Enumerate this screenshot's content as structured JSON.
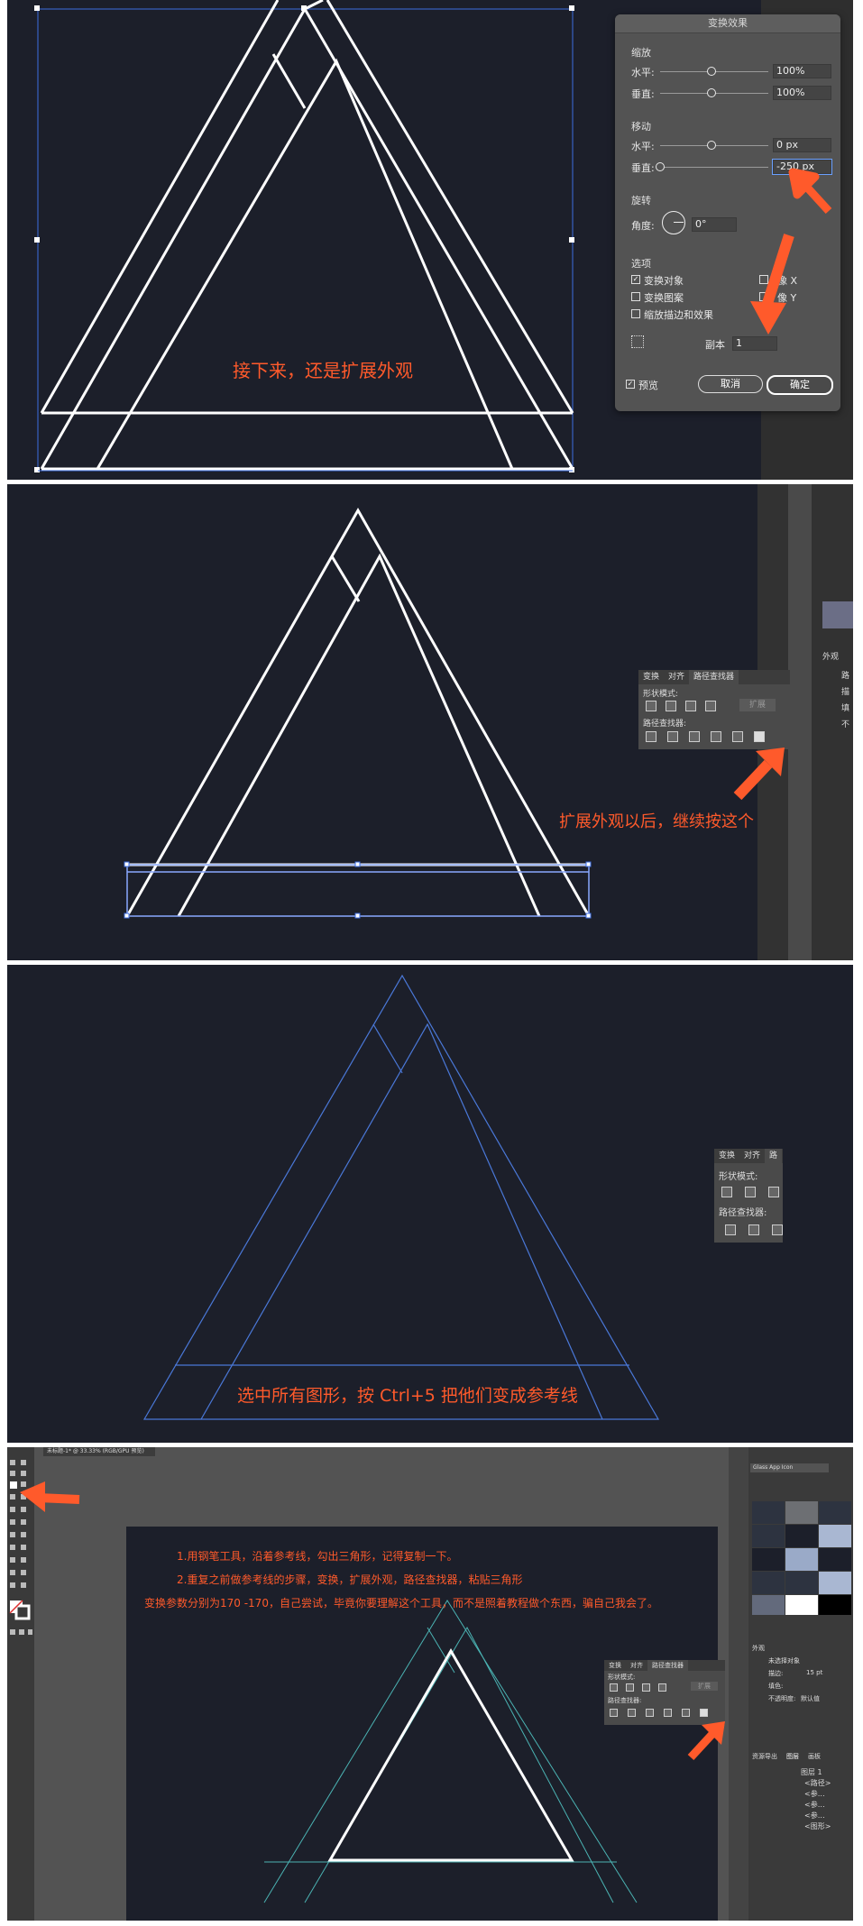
{
  "step1": {
    "caption": "接下来，还是扩展外观",
    "dialog": {
      "title": "变换效果",
      "scale": {
        "label": "缩放",
        "h_label": "水平:",
        "h_value": "100%",
        "v_label": "垂直:",
        "v_value": "100%"
      },
      "move": {
        "label": "移动",
        "h_label": "水平:",
        "h_value": "0 px",
        "v_label": "垂直:",
        "v_value": "-250 px"
      },
      "rotate": {
        "label": "旋转",
        "angle_label": "角度:",
        "angle_value": "0°"
      },
      "options": {
        "label": "选项",
        "transform_objects": "变换对象",
        "transform_patterns": "变换图案",
        "scale_strokes": "缩放描边和效果",
        "mirror_x": "像 X",
        "mirror_y": "像 Y"
      },
      "copies_label": "副本",
      "copies_value": "1",
      "preview_label": "预览",
      "cancel": "取消",
      "ok": "确定"
    }
  },
  "step2": {
    "caption": "扩展外观以后，继续按这个",
    "pathfinder": {
      "tabs": [
        "变换",
        "对齐",
        "路径查找器"
      ],
      "shape_modes": "形状模式:",
      "pathfinders": "路径查找器:",
      "expand": "扩展"
    },
    "side_labels": [
      "外观",
      "路",
      "描",
      "填",
      "不"
    ]
  },
  "step3": {
    "caption": "选中所有图形，按 Ctrl+5 把他们变成参考线",
    "pathfinder": {
      "tabs": [
        "变换",
        "对齐",
        "路"
      ],
      "shape_modes": "形状模式:",
      "pathfinders": "路径查找器:"
    }
  },
  "step4": {
    "doc_tab": "未标题-1* @ 33.33% (RGB/GPU 预览)",
    "lines": [
      "1.用钢笔工具，沿着参考线，勾出三角形，记得复制一下。",
      "2.重复之前做参考线的步骤，变换，扩展外观，路径查找器，粘贴三角形",
      "变换参数分别为170 -170，自己尝试，毕竟你要理解这个工具，而不是照着教程做个东西，骗自己我会了。"
    ],
    "pathfinder": {
      "tabs": [
        "变换",
        "对齐",
        "路径查找器"
      ],
      "shape_modes": "形状模式:",
      "pathfinders": "路径查找器:",
      "expand": "扩展"
    },
    "swatch_lib": "Glass App Icon",
    "appearance": {
      "title": "外观",
      "object": "未选择对象",
      "stroke_label": "描边:",
      "stroke_value": "15 pt",
      "fill_label": "填色:",
      "opacity_label": "不透明度:",
      "opacity_value": "默认值"
    },
    "layers": {
      "tabs": [
        "资源导出",
        "图层",
        "画板"
      ],
      "items": [
        "图层 1",
        "<路径>",
        "<参…",
        "<参…",
        "<参…",
        "<图形>"
      ]
    }
  },
  "colors": {
    "canvas": "#1c1f2a",
    "accent": "#ff5a2b",
    "guide": "#4a78d8",
    "teal": "#4bb3b3"
  }
}
